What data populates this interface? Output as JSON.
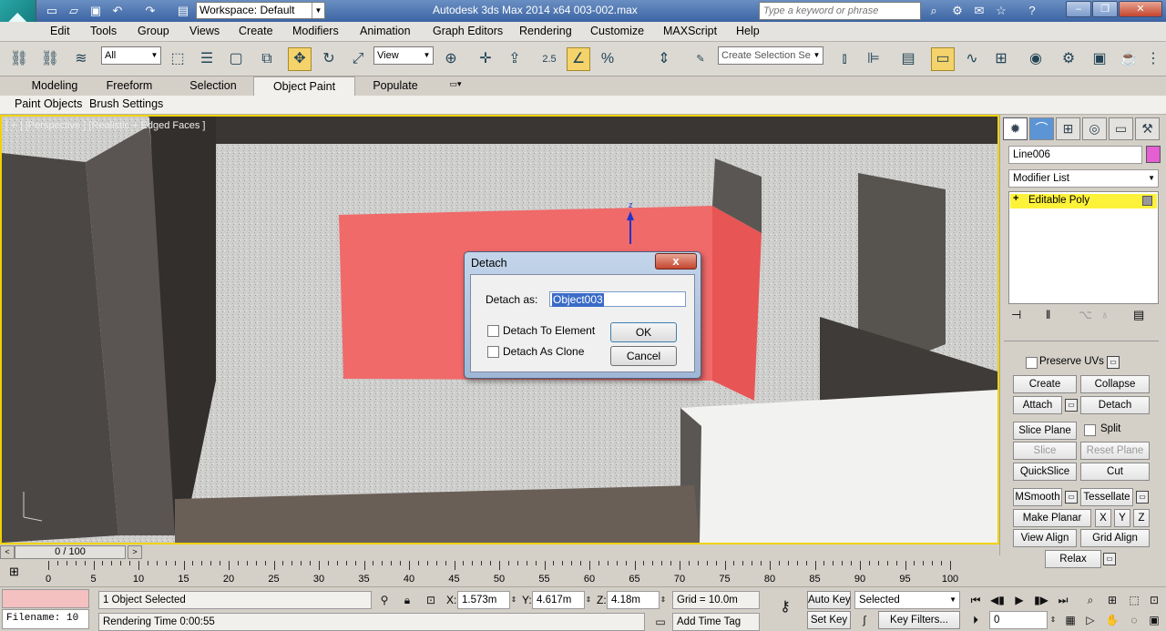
{
  "titlebar": {
    "workspace": "Workspace: Default",
    "app_title": "Autodesk 3ds Max  2014 x64      003-002.max",
    "search_placeholder": "Type a keyword or phrase"
  },
  "menu": [
    "Edit",
    "Tools",
    "Group",
    "Views",
    "Create",
    "Modifiers",
    "Animation",
    "Graph Editors",
    "Rendering",
    "Customize",
    "MAXScript",
    "Help"
  ],
  "toolbar": {
    "filter": "All",
    "ref_coord": "View",
    "selection_set": "Create Selection Se",
    "snap_label": "2.5"
  },
  "ribbon": {
    "tabs": [
      "Modeling",
      "Freeform",
      "Selection",
      "Object Paint",
      "Populate"
    ],
    "active": "Object Paint",
    "subtabs": [
      "Paint Objects",
      "Brush Settings"
    ]
  },
  "viewport": {
    "label": "[ + ] [Perspective ] [Realistic + Edged Faces ]",
    "gizmo_axis": "z"
  },
  "dialog": {
    "title": "Detach",
    "close": "x",
    "detach_as_label": "Detach as:",
    "detach_as_value": "Object003",
    "to_element": "Detach To Element",
    "as_clone": "Detach As Clone",
    "ok": "OK",
    "cancel": "Cancel"
  },
  "command_panel": {
    "object_name": "Line006",
    "object_color": "#e45fd2",
    "modifier_list": "Modifier List",
    "stack_item": "Editable Poly",
    "preserve_uvs": "Preserve UVs",
    "buttons": {
      "create": "Create",
      "collapse": "Collapse",
      "attach": "Attach",
      "detach": "Detach",
      "slice_plane": "Slice Plane",
      "split": "Split",
      "slice": "Slice",
      "reset_plane": "Reset Plane",
      "quickslice": "QuickSlice",
      "cut": "Cut",
      "msmooth": "MSmooth",
      "tessellate": "Tessellate",
      "make_planar": "Make Planar",
      "x": "X",
      "y": "Y",
      "z": "Z",
      "view_align": "View Align",
      "grid_align": "Grid Align",
      "relax": "Relax"
    }
  },
  "timeline": {
    "frame": "0 / 100",
    "ticks": [
      "0",
      "5",
      "10",
      "15",
      "20",
      "25",
      "30",
      "35",
      "40",
      "45",
      "50",
      "55",
      "60",
      "65",
      "70",
      "75",
      "80",
      "85",
      "90",
      "95",
      "100"
    ]
  },
  "status": {
    "maxscript": "Filename: 10",
    "selected": "1 Object Selected",
    "rendering_time": "Rendering Time  0:00:55",
    "x_label": "X:",
    "x": "1.573m",
    "y_label": "Y:",
    "y": "4.617m",
    "z_label": "Z:",
    "z": "4.18m",
    "grid": "Grid = 10.0m",
    "add_time_tag": "Add Time Tag",
    "auto_key": "Auto Key",
    "set_key": "Set Key",
    "selected_dropdown": "Selected",
    "key_filters": "Key Filters...",
    "frame_field": "0"
  }
}
